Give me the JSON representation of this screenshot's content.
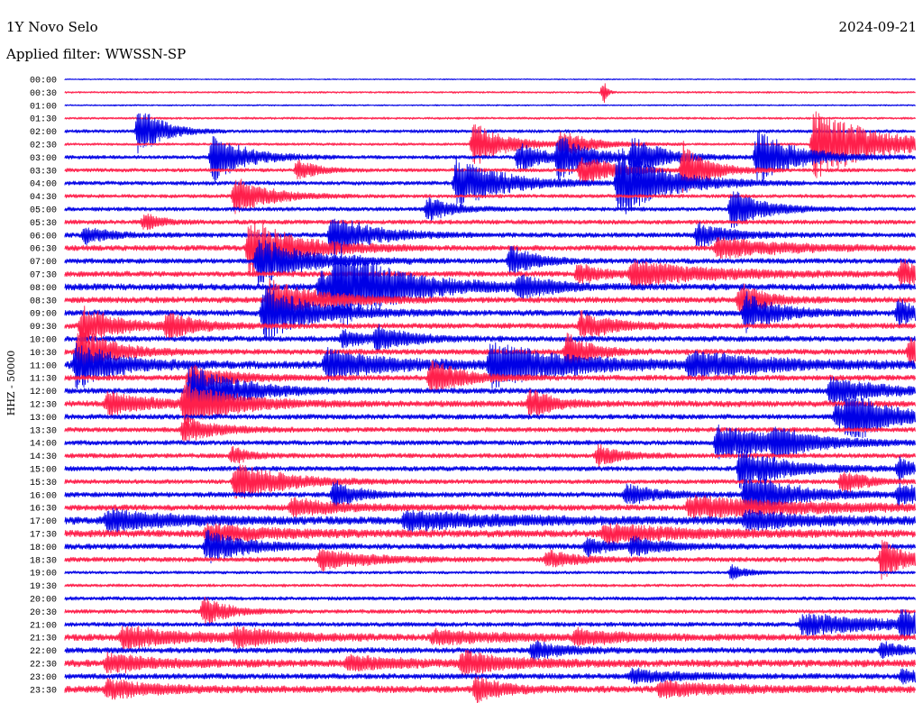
{
  "header": {
    "station": "1Y Novo Selo",
    "date": "2024-09-21",
    "filter_label": "Applied filter: WWSSN-SP"
  },
  "chart_data": {
    "type": "line",
    "ylabel": "HHZ - 50000",
    "series_colors": [
      "#0000e6",
      "#ff1f4b"
    ],
    "categories": [
      "00:00",
      "00:30",
      "01:00",
      "01:30",
      "02:00",
      "02:30",
      "03:00",
      "03:30",
      "04:00",
      "04:30",
      "05:00",
      "05:30",
      "06:00",
      "06:30",
      "07:00",
      "07:30",
      "08:00",
      "08:30",
      "09:00",
      "09:30",
      "10:00",
      "10:30",
      "11:00",
      "11:30",
      "12:00",
      "12:30",
      "13:00",
      "13:30",
      "14:00",
      "14:30",
      "15:00",
      "15:30",
      "16:00",
      "16:30",
      "17:00",
      "17:30",
      "18:00",
      "18:30",
      "19:00",
      "19:30",
      "20:00",
      "20:30",
      "21:00",
      "21:30",
      "22:00",
      "22:30",
      "23:00",
      "23:30"
    ],
    "row_noise": [
      0.6,
      1.0,
      0.8,
      1.2,
      1.8,
      1.4,
      2.0,
      2.0,
      2.2,
      2.0,
      2.2,
      2.4,
      2.6,
      3.0,
      2.8,
      3.0,
      3.6,
      3.2,
      3.2,
      3.0,
      3.0,
      3.0,
      4.2,
      3.0,
      3.0,
      3.4,
      2.8,
      2.6,
      2.6,
      2.6,
      2.6,
      2.4,
      2.8,
      3.2,
      4.2,
      4.0,
      3.0,
      2.6,
      1.6,
      1.6,
      2.0,
      2.2,
      2.4,
      3.6,
      3.0,
      4.0,
      3.0,
      3.8
    ],
    "events": [
      {
        "row": 1,
        "minute": 19.0,
        "amp": 14,
        "dur": 0.2
      },
      {
        "row": 4,
        "minute": 2.6,
        "amp": 30,
        "dur": 1.4
      },
      {
        "row": 5,
        "minute": 14.4,
        "amp": 26,
        "dur": 2.0
      },
      {
        "row": 5,
        "minute": 26.4,
        "amp": 40,
        "dur": 4.0
      },
      {
        "row": 5,
        "minute": 17.5,
        "amp": 14,
        "dur": 2.0
      },
      {
        "row": 6,
        "minute": 17.4,
        "amp": 24,
        "dur": 2.0
      },
      {
        "row": 6,
        "minute": 24.4,
        "amp": 30,
        "dur": 2.5
      },
      {
        "row": 6,
        "minute": 5.2,
        "amp": 28,
        "dur": 2.0
      },
      {
        "row": 6,
        "minute": 20.0,
        "amp": 22,
        "dur": 2.0
      },
      {
        "row": 6,
        "minute": 16.0,
        "amp": 18,
        "dur": 1.5
      },
      {
        "row": 7,
        "minute": 21.8,
        "amp": 30,
        "dur": 1.6
      },
      {
        "row": 7,
        "minute": 8.2,
        "amp": 12,
        "dur": 1.2
      },
      {
        "row": 7,
        "minute": 18.2,
        "amp": 18,
        "dur": 2.0
      },
      {
        "row": 8,
        "minute": 13.8,
        "amp": 28,
        "dur": 3.0
      },
      {
        "row": 8,
        "minute": 19.5,
        "amp": 40,
        "dur": 3.0
      },
      {
        "row": 9,
        "minute": 6.0,
        "amp": 22,
        "dur": 2.0
      },
      {
        "row": 10,
        "minute": 12.8,
        "amp": 14,
        "dur": 1.5
      },
      {
        "row": 10,
        "minute": 23.5,
        "amp": 22,
        "dur": 2.0
      },
      {
        "row": 11,
        "minute": 2.8,
        "amp": 10,
        "dur": 1.0
      },
      {
        "row": 12,
        "minute": 22.3,
        "amp": 14,
        "dur": 2.0
      },
      {
        "row": 12,
        "minute": 9.4,
        "amp": 24,
        "dur": 2.5
      },
      {
        "row": 12,
        "minute": 0.7,
        "amp": 10,
        "dur": 1.5
      },
      {
        "row": 13,
        "minute": 6.5,
        "amp": 34,
        "dur": 3.0
      },
      {
        "row": 13,
        "minute": 23.0,
        "amp": 12,
        "dur": 4.0
      },
      {
        "row": 14,
        "minute": 6.8,
        "amp": 26,
        "dur": 3.0
      },
      {
        "row": 14,
        "minute": 15.7,
        "amp": 18,
        "dur": 1.5
      },
      {
        "row": 15,
        "minute": 18.1,
        "amp": 12,
        "dur": 1.5
      },
      {
        "row": 15,
        "minute": 20.0,
        "amp": 14,
        "dur": 5.0
      },
      {
        "row": 15,
        "minute": 29.5,
        "amp": 16,
        "dur": 1.5
      },
      {
        "row": 16,
        "minute": 9.0,
        "amp": 16,
        "dur": 2.0
      },
      {
        "row": 16,
        "minute": 9.5,
        "amp": 44,
        "dur": 4.0
      },
      {
        "row": 16,
        "minute": 16.0,
        "amp": 12,
        "dur": 2.0
      },
      {
        "row": 17,
        "minute": 7.2,
        "amp": 24,
        "dur": 3.0
      },
      {
        "row": 17,
        "minute": 23.8,
        "amp": 20,
        "dur": 1.5
      },
      {
        "row": 18,
        "minute": 7.0,
        "amp": 30,
        "dur": 3.0
      },
      {
        "row": 18,
        "minute": 24.0,
        "amp": 22,
        "dur": 2.0
      },
      {
        "row": 18,
        "minute": 29.4,
        "amp": 18,
        "dur": 1.0
      },
      {
        "row": 19,
        "minute": 0.6,
        "amp": 24,
        "dur": 2.0
      },
      {
        "row": 19,
        "minute": 3.6,
        "amp": 14,
        "dur": 2.0
      },
      {
        "row": 19,
        "minute": 18.2,
        "amp": 16,
        "dur": 2.0
      },
      {
        "row": 20,
        "minute": 11.0,
        "amp": 14,
        "dur": 2.0
      },
      {
        "row": 20,
        "minute": 9.8,
        "amp": 10,
        "dur": 1.5
      },
      {
        "row": 21,
        "minute": 0.5,
        "amp": 30,
        "dur": 2.0
      },
      {
        "row": 21,
        "minute": 17.7,
        "amp": 20,
        "dur": 1.5
      },
      {
        "row": 21,
        "minute": 29.8,
        "amp": 16,
        "dur": 1.0
      },
      {
        "row": 22,
        "minute": 0.4,
        "amp": 26,
        "dur": 2.5
      },
      {
        "row": 22,
        "minute": 9.2,
        "amp": 16,
        "dur": 4.0
      },
      {
        "row": 22,
        "minute": 15.0,
        "amp": 24,
        "dur": 5.0
      },
      {
        "row": 22,
        "minute": 22.0,
        "amp": 14,
        "dur": 5.0
      },
      {
        "row": 23,
        "minute": 12.9,
        "amp": 20,
        "dur": 2.0
      },
      {
        "row": 23,
        "minute": 4.4,
        "amp": 14,
        "dur": 2.5
      },
      {
        "row": 24,
        "minute": 27.0,
        "amp": 16,
        "dur": 3.0
      },
      {
        "row": 24,
        "minute": 4.4,
        "amp": 30,
        "dur": 3.0
      },
      {
        "row": 25,
        "minute": 4.2,
        "amp": 24,
        "dur": 3.0
      },
      {
        "row": 25,
        "minute": 16.4,
        "amp": 16,
        "dur": 1.5
      },
      {
        "row": 25,
        "minute": 1.5,
        "amp": 12,
        "dur": 3.0
      },
      {
        "row": 26,
        "minute": 27.6,
        "amp": 22,
        "dur": 2.5
      },
      {
        "row": 26,
        "minute": 27.2,
        "amp": 14,
        "dur": 2.5
      },
      {
        "row": 27,
        "minute": 4.2,
        "amp": 14,
        "dur": 2.0
      },
      {
        "row": 28,
        "minute": 23.0,
        "amp": 20,
        "dur": 4.0
      },
      {
        "row": 28,
        "minute": 25.0,
        "amp": 14,
        "dur": 2.0
      },
      {
        "row": 29,
        "minute": 18.8,
        "amp": 12,
        "dur": 1.5
      },
      {
        "row": 29,
        "minute": 5.9,
        "amp": 10,
        "dur": 1.0
      },
      {
        "row": 30,
        "minute": 23.8,
        "amp": 22,
        "dur": 3.0
      },
      {
        "row": 30,
        "minute": 29.4,
        "amp": 12,
        "dur": 1.0
      },
      {
        "row": 31,
        "minute": 6.0,
        "amp": 22,
        "dur": 3.0
      },
      {
        "row": 31,
        "minute": 27.4,
        "amp": 14,
        "dur": 1.5
      },
      {
        "row": 32,
        "minute": 24.0,
        "amp": 24,
        "dur": 3.0
      },
      {
        "row": 32,
        "minute": 9.5,
        "amp": 16,
        "dur": 1.5
      },
      {
        "row": 32,
        "minute": 19.8,
        "amp": 12,
        "dur": 2.0
      },
      {
        "row": 32,
        "minute": 29.4,
        "amp": 14,
        "dur": 1.5
      },
      {
        "row": 33,
        "minute": 22.0,
        "amp": 12,
        "dur": 8.0
      },
      {
        "row": 33,
        "minute": 8.0,
        "amp": 10,
        "dur": 3.0
      },
      {
        "row": 34,
        "minute": 1.5,
        "amp": 12,
        "dur": 4.0
      },
      {
        "row": 34,
        "minute": 12.0,
        "amp": 10,
        "dur": 6.0
      },
      {
        "row": 34,
        "minute": 24.0,
        "amp": 10,
        "dur": 4.0
      },
      {
        "row": 35,
        "minute": 5.0,
        "amp": 10,
        "dur": 4.0
      },
      {
        "row": 35,
        "minute": 19.0,
        "amp": 10,
        "dur": 5.0
      },
      {
        "row": 36,
        "minute": 5.0,
        "amp": 18,
        "dur": 2.5
      },
      {
        "row": 36,
        "minute": 18.4,
        "amp": 10,
        "dur": 1.5
      },
      {
        "row": 36,
        "minute": 20.0,
        "amp": 10,
        "dur": 2.0
      },
      {
        "row": 37,
        "minute": 9.0,
        "amp": 12,
        "dur": 3.0
      },
      {
        "row": 37,
        "minute": 28.8,
        "amp": 22,
        "dur": 1.5
      },
      {
        "row": 37,
        "minute": 17.0,
        "amp": 10,
        "dur": 2.0
      },
      {
        "row": 38,
        "minute": 23.5,
        "amp": 8,
        "dur": 1.0
      },
      {
        "row": 41,
        "minute": 4.9,
        "amp": 16,
        "dur": 1.5
      },
      {
        "row": 42,
        "minute": 26.0,
        "amp": 12,
        "dur": 6.0
      },
      {
        "row": 42,
        "minute": 29.5,
        "amp": 14,
        "dur": 2.0
      },
      {
        "row": 43,
        "minute": 2.0,
        "amp": 12,
        "dur": 4.0
      },
      {
        "row": 43,
        "minute": 6.0,
        "amp": 10,
        "dur": 3.0
      },
      {
        "row": 43,
        "minute": 13.0,
        "amp": 8,
        "dur": 4.0
      },
      {
        "row": 43,
        "minute": 18.0,
        "amp": 8,
        "dur": 3.0
      },
      {
        "row": 44,
        "minute": 16.5,
        "amp": 10,
        "dur": 2.0
      },
      {
        "row": 44,
        "minute": 28.8,
        "amp": 8,
        "dur": 2.0
      },
      {
        "row": 45,
        "minute": 1.5,
        "amp": 10,
        "dur": 3.0
      },
      {
        "row": 45,
        "minute": 10.0,
        "amp": 8,
        "dur": 3.0
      },
      {
        "row": 45,
        "minute": 14.0,
        "amp": 12,
        "dur": 3.0
      },
      {
        "row": 46,
        "minute": 20.0,
        "amp": 8,
        "dur": 3.0
      },
      {
        "row": 46,
        "minute": 29.5,
        "amp": 8,
        "dur": 1.5
      },
      {
        "row": 47,
        "minute": 14.5,
        "amp": 16,
        "dur": 1.5
      },
      {
        "row": 47,
        "minute": 1.5,
        "amp": 10,
        "dur": 3.0
      },
      {
        "row": 47,
        "minute": 21.0,
        "amp": 8,
        "dur": 4.0
      }
    ]
  }
}
